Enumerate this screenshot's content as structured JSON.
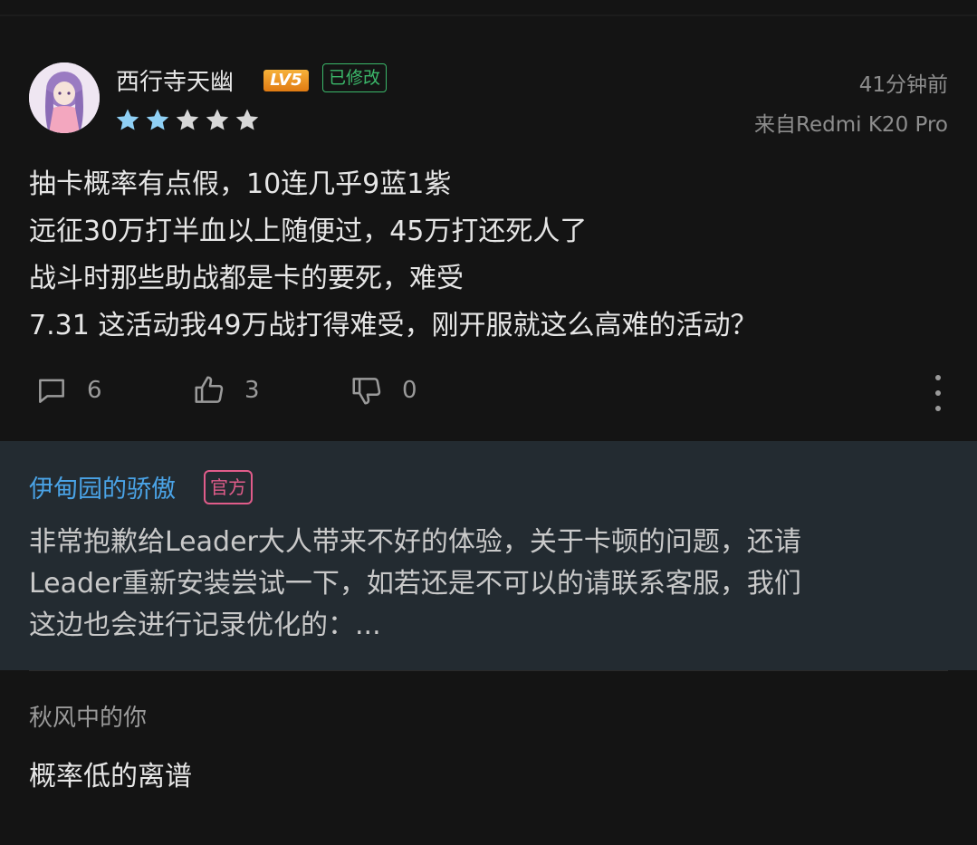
{
  "post": {
    "username": "西行寺天幽",
    "level": "LV5",
    "edited_label": "已修改",
    "rating": 2,
    "rating_max": 5,
    "time": "41分钟前",
    "device": "来自Redmi K20 Pro",
    "lines": [
      "抽卡概率有点假，10连几乎9蓝1紫",
      "远征30万打半血以上随便过，45万打还死人了",
      "战斗时那些助战都是卡的要死，难受",
      "7.31 这活动我49万战打得难受，刚开服就这么高难的活动？"
    ],
    "actions": {
      "comments": "6",
      "likes": "3",
      "dislikes": "0"
    }
  },
  "official_reply": {
    "author": "伊甸园的骄傲",
    "badge": "官方",
    "lines": [
      "非常抱歉给Leader大人带来不好的体验，关于卡顿的问题，还请",
      "Leader重新安装尝试一下，如若还是不可以的请联系客服，我们",
      "这边也会进行记录优化的：..."
    ]
  },
  "reply": {
    "author": "秋风中的你",
    "text": "概率低的离谱"
  },
  "colors": {
    "background": "#141414",
    "reply_box": "#232b31",
    "accent_blue": "#4aa3e6",
    "edited_green": "#3bb86a",
    "official_pink": "#e05c8a",
    "star_filled": "#8fd0f5",
    "star_empty": "#d8d8d8"
  }
}
